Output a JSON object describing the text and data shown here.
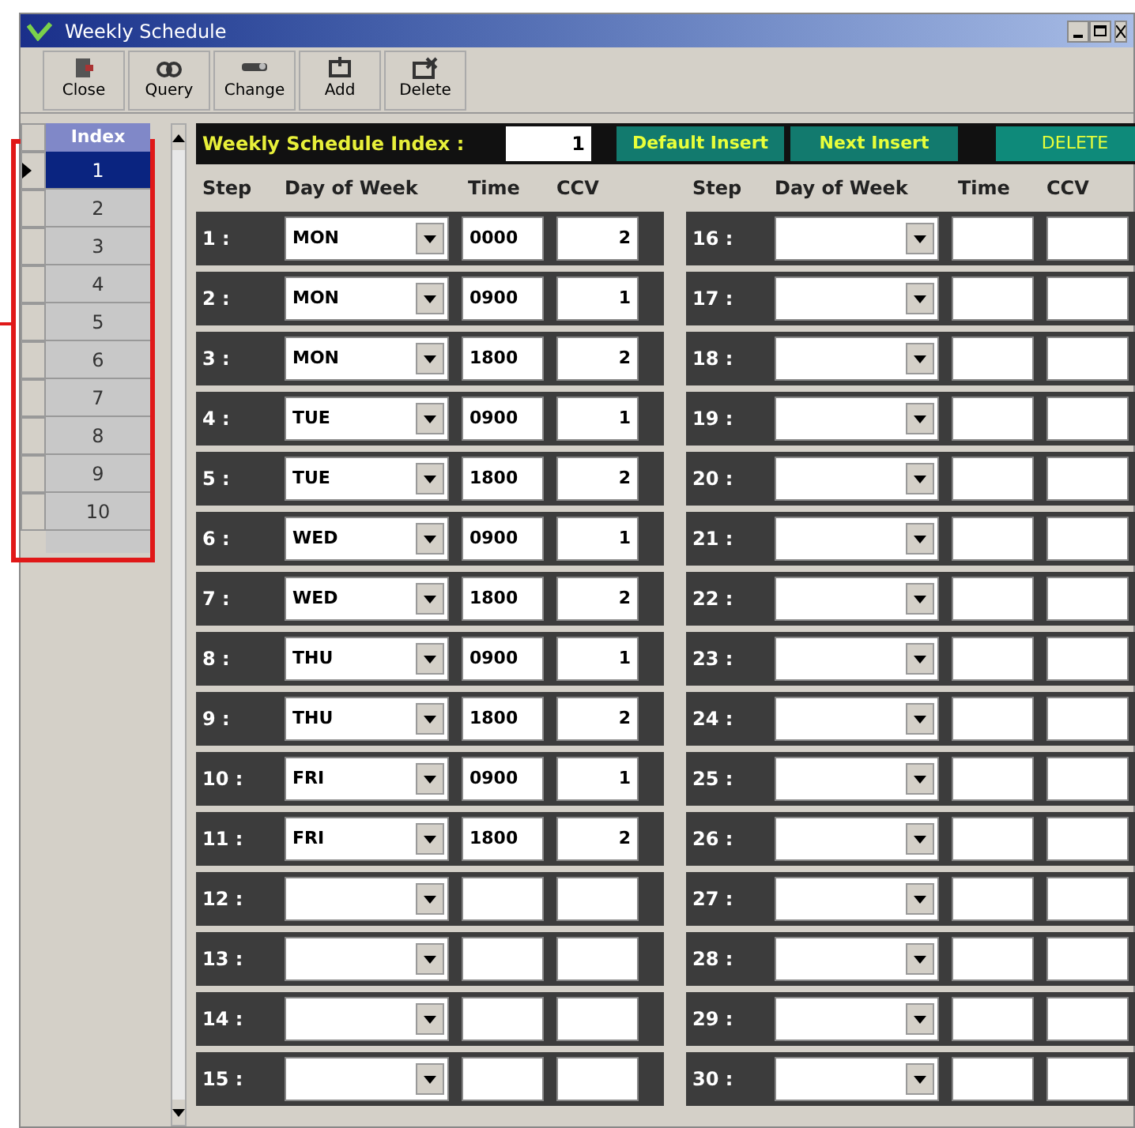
{
  "window": {
    "title": "Weekly Schedule"
  },
  "toolbar": [
    {
      "label": "Close",
      "kind": "close"
    },
    {
      "label": "Query",
      "kind": "query"
    },
    {
      "label": "Change",
      "kind": "change"
    },
    {
      "label": "Add",
      "kind": "add"
    },
    {
      "label": "Delete",
      "kind": "delete"
    }
  ],
  "index_list": {
    "header": "Index",
    "rows": [
      {
        "label": "1",
        "selected": true
      },
      {
        "label": "2",
        "selected": false
      },
      {
        "label": "3",
        "selected": false
      },
      {
        "label": "4",
        "selected": false
      },
      {
        "label": "5",
        "selected": false
      },
      {
        "label": "6",
        "selected": false
      },
      {
        "label": "7",
        "selected": false
      },
      {
        "label": "8",
        "selected": false
      },
      {
        "label": "9",
        "selected": false
      },
      {
        "label": "10",
        "selected": false
      }
    ]
  },
  "index_bar": {
    "label": "Weekly Schedule Index :",
    "value": "1",
    "buttons": [
      "Default Insert",
      "Next Insert",
      "DELETE"
    ]
  },
  "columns": [
    [
      "Step",
      "Day of Week",
      "Time",
      "CCV"
    ],
    [
      "Step",
      "Day of Week",
      "Time",
      "CCV"
    ]
  ],
  "steps": [
    {
      "step": "1 :",
      "day": "MON",
      "time": "0000",
      "ccv": "2"
    },
    {
      "step": "2 :",
      "day": "MON",
      "time": "0900",
      "ccv": "1"
    },
    {
      "step": "3 :",
      "day": "MON",
      "time": "1800",
      "ccv": "2"
    },
    {
      "step": "4 :",
      "day": "TUE",
      "time": "0900",
      "ccv": "1"
    },
    {
      "step": "5 :",
      "day": "TUE",
      "time": "1800",
      "ccv": "2"
    },
    {
      "step": "6 :",
      "day": "WED",
      "time": "0900",
      "ccv": "1"
    },
    {
      "step": "7 :",
      "day": "WED",
      "time": "1800",
      "ccv": "2"
    },
    {
      "step": "8 :",
      "day": "THU",
      "time": "0900",
      "ccv": "1"
    },
    {
      "step": "9 :",
      "day": "THU",
      "time": "1800",
      "ccv": "2"
    },
    {
      "step": "10 :",
      "day": "FRI",
      "time": "0900",
      "ccv": "1"
    },
    {
      "step": "11 :",
      "day": "FRI",
      "time": "1800",
      "ccv": "2"
    },
    {
      "step": "12 :"
    },
    {
      "step": "13 :"
    },
    {
      "step": "14 :"
    },
    {
      "step": "15 :"
    },
    {
      "step": "16 :"
    },
    {
      "step": "17 :"
    },
    {
      "step": "18 :"
    },
    {
      "step": "19 :"
    },
    {
      "step": "20 :"
    },
    {
      "step": "21 :"
    },
    {
      "step": "22 :"
    },
    {
      "step": "23 :"
    },
    {
      "step": "24 :"
    },
    {
      "step": "25 :"
    },
    {
      "step": "26 :"
    },
    {
      "step": "27 :"
    },
    {
      "step": "28 :"
    },
    {
      "step": "29 :"
    },
    {
      "step": "30 :"
    }
  ]
}
